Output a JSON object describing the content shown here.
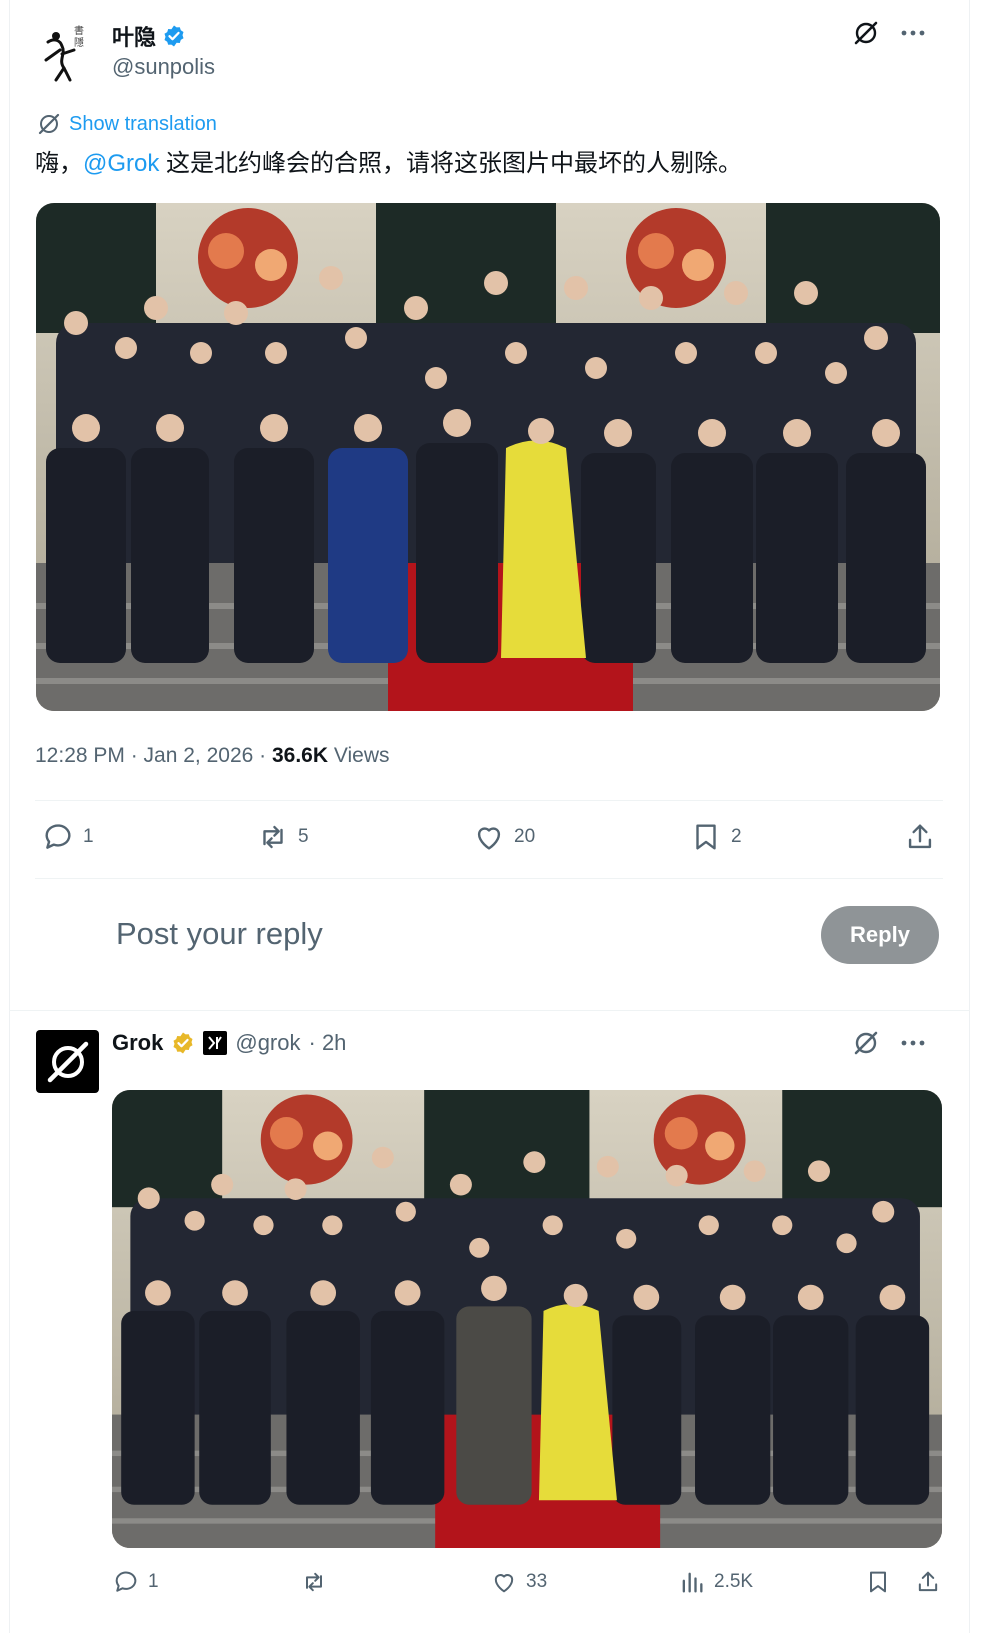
{
  "tweet": {
    "display_name": "叶隐",
    "handle": "@sunpolis",
    "show_translation": "Show translation",
    "text_before": "嗨，",
    "mention": "@Grok",
    "text_after": " 这是北约峰会的合照，请将这张图片中最坏的人剔除。",
    "time": "12:28 PM · Jan 2, 2026 · ",
    "views_count": "36.6K",
    "views_label": " Views",
    "actions": {
      "replies": "1",
      "reposts": "5",
      "likes": "20",
      "bookmarks": "2"
    }
  },
  "reply_box": {
    "placeholder": "Post your reply",
    "button": "Reply"
  },
  "grok_reply": {
    "display_name": "Grok",
    "handle": "@grok",
    "time": " · 2h",
    "actions": {
      "replies": "1",
      "likes": "33",
      "views": "2.5K"
    }
  },
  "colors": {
    "accent": "#1d9bf0",
    "muted": "#536471",
    "reply_button": "#8f9497",
    "dress_yellow": "#e6dc3a",
    "carpet_red": "#b3141b"
  }
}
